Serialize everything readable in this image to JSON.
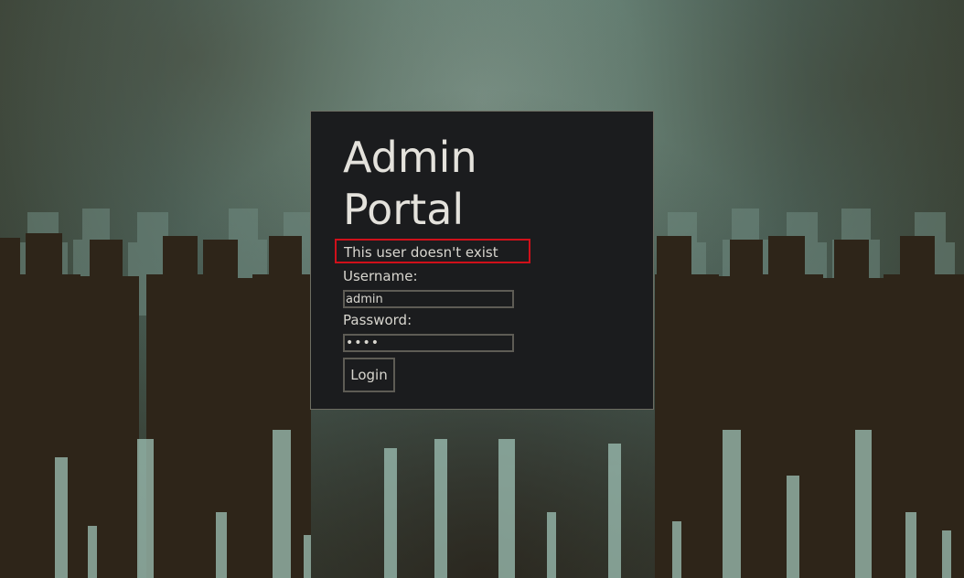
{
  "login": {
    "title": "Admin Portal",
    "error_message": "This user doesn't exist",
    "username_label": "Username:",
    "username_value": "admin",
    "password_label": "Password:",
    "password_value": "abcd",
    "submit_label": "Login"
  },
  "colors": {
    "panel_background": "#1b1c1e",
    "error_border": "#d0101a",
    "text": "#d8d6cf"
  }
}
